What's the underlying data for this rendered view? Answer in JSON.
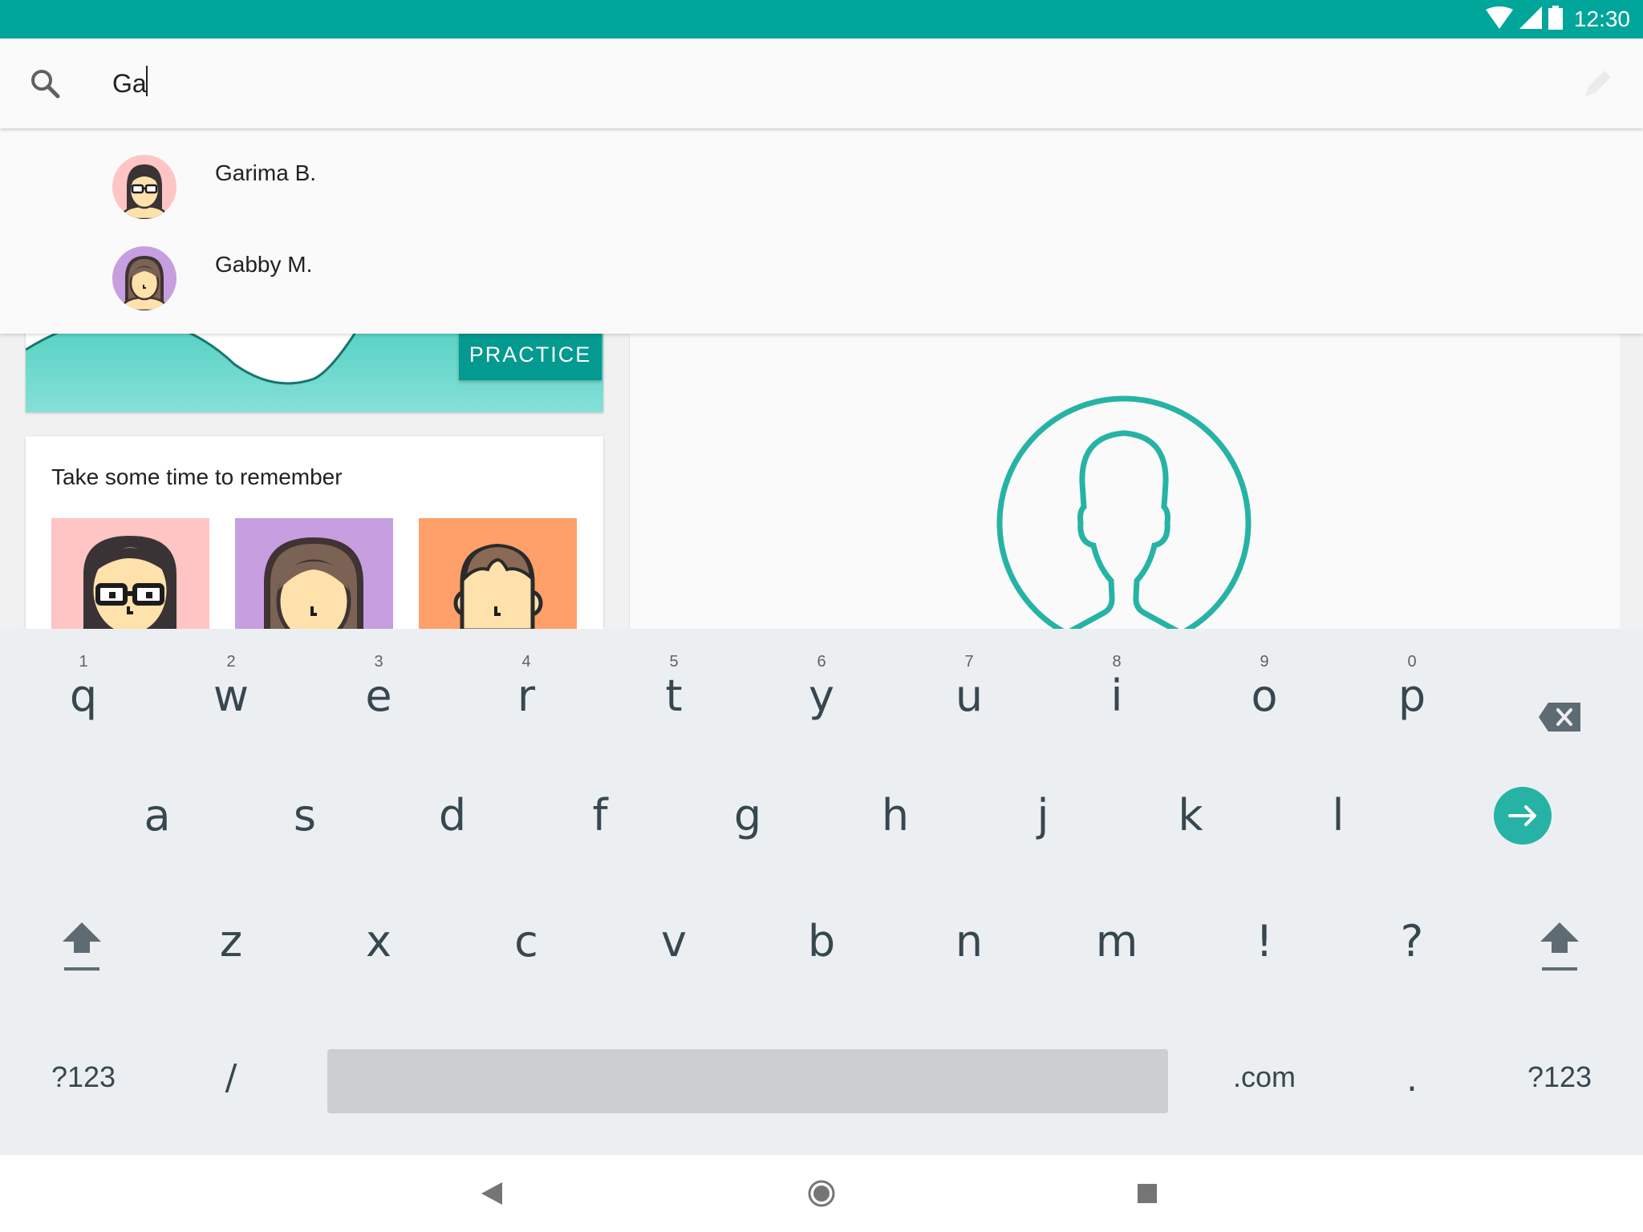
{
  "status_bar": {
    "time": "12:30"
  },
  "search": {
    "query": "Ga"
  },
  "suggestions": [
    {
      "name": "Garima B."
    },
    {
      "name": "Gabby M."
    }
  ],
  "practice": {
    "button_label": "PRACTICE"
  },
  "remember": {
    "title": "Take some time to remember"
  },
  "keyboard": {
    "row1": [
      {
        "hint": "1",
        "key": "q"
      },
      {
        "hint": "2",
        "key": "w"
      },
      {
        "hint": "3",
        "key": "e"
      },
      {
        "hint": "4",
        "key": "r"
      },
      {
        "hint": "5",
        "key": "t"
      },
      {
        "hint": "6",
        "key": "y"
      },
      {
        "hint": "7",
        "key": "u"
      },
      {
        "hint": "8",
        "key": "i"
      },
      {
        "hint": "9",
        "key": "o"
      },
      {
        "hint": "0",
        "key": "p"
      }
    ],
    "row2": [
      "a",
      "s",
      "d",
      "f",
      "g",
      "h",
      "j",
      "k",
      "l"
    ],
    "row3": [
      "z",
      "x",
      "c",
      "v",
      "b",
      "n",
      "m",
      "!",
      "?"
    ],
    "row4": {
      "symbols_left": "?123",
      "slash": "/",
      "dotcom": ".com",
      "period": ".",
      "symbols_right": "?123"
    }
  },
  "colors": {
    "status_bar": "#00a69a",
    "accent": "#26b3a5",
    "practice_button": "#049a8f",
    "keyboard_bg": "#eceff1"
  }
}
